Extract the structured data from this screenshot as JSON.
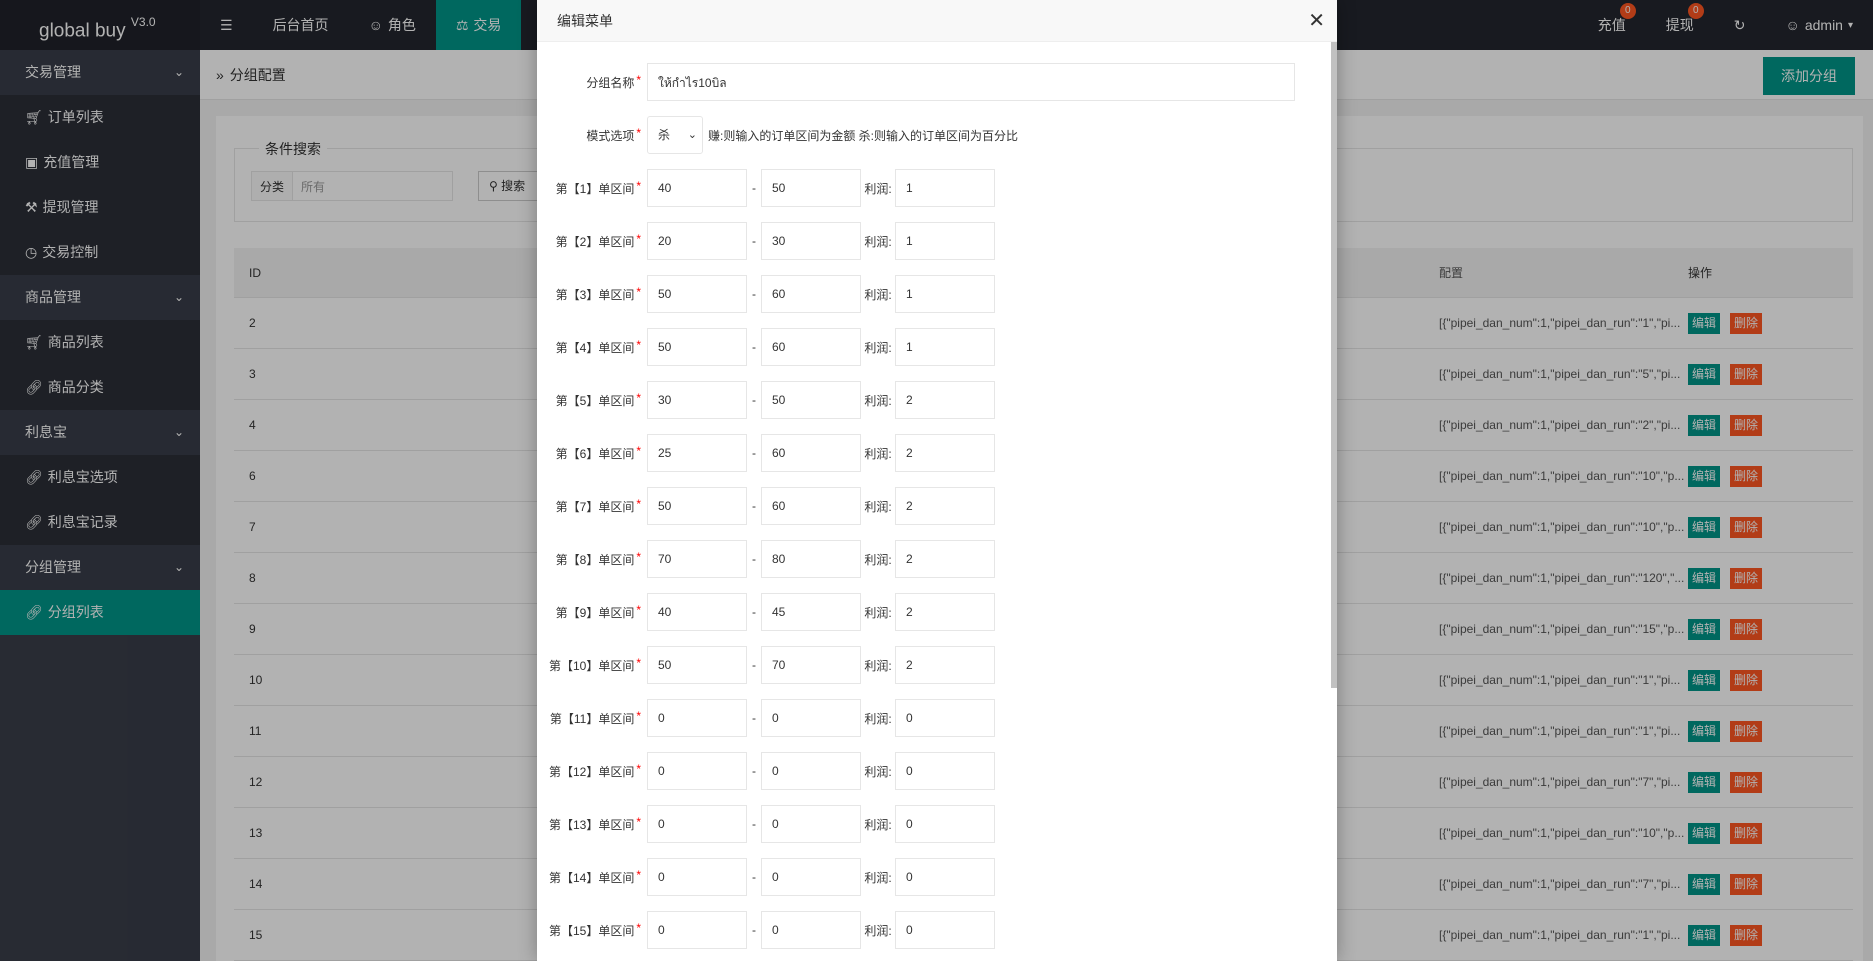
{
  "app": {
    "name": "global buy",
    "version": "V3.0"
  },
  "topnav": {
    "items": [
      {
        "label": "后台首页",
        "icon": "home-icon"
      },
      {
        "label": "角色",
        "icon": "user-icon"
      },
      {
        "label": "交易",
        "icon": "scale-icon"
      }
    ]
  },
  "topright": {
    "recharge": {
      "label": "充值",
      "count": "0"
    },
    "withdraw": {
      "label": "提现",
      "count": "0"
    },
    "user": "admin"
  },
  "sidebar": {
    "groups": [
      {
        "label": "交易管理",
        "items": [
          {
            "label": "订单列表",
            "icon": "cart-icon"
          },
          {
            "label": "充值管理",
            "icon": "card-icon"
          },
          {
            "label": "提现管理",
            "icon": "hammer-icon"
          },
          {
            "label": "交易控制",
            "icon": "gauge-icon"
          }
        ]
      },
      {
        "label": "商品管理",
        "items": [
          {
            "label": "商品列表",
            "icon": "cart-icon"
          },
          {
            "label": "商品分类",
            "icon": "link-icon"
          }
        ]
      },
      {
        "label": "利息宝",
        "items": [
          {
            "label": "利息宝选项",
            "icon": "link-icon"
          },
          {
            "label": "利息宝记录",
            "icon": "link-icon"
          }
        ]
      },
      {
        "label": "分组管理",
        "items": [
          {
            "label": "分组列表",
            "icon": "link-icon",
            "active": true
          }
        ]
      }
    ]
  },
  "page": {
    "breadcrumb": "分组配置",
    "add_button": "添加分组",
    "search": {
      "legend": "条件搜索",
      "category_label": "分类",
      "category_value": "所有",
      "search_button": "搜索"
    },
    "table": {
      "headers": {
        "id": "ID",
        "config": "配置",
        "ops": "操作"
      },
      "edit_label": "编辑",
      "delete_label": "删除",
      "rows": [
        {
          "id": "2",
          "config": "[{\"pipei_dan_num\":1,\"pipei_dan_run\":\"1\",\"pi..."
        },
        {
          "id": "3",
          "config": "[{\"pipei_dan_num\":1,\"pipei_dan_run\":\"5\",\"pi..."
        },
        {
          "id": "4",
          "config": "[{\"pipei_dan_num\":1,\"pipei_dan_run\":\"2\",\"pi..."
        },
        {
          "id": "6",
          "config": "[{\"pipei_dan_num\":1,\"pipei_dan_run\":\"10\",\"p..."
        },
        {
          "id": "7",
          "config": "[{\"pipei_dan_num\":1,\"pipei_dan_run\":\"10\",\"p..."
        },
        {
          "id": "8",
          "config": "[{\"pipei_dan_num\":1,\"pipei_dan_run\":\"120\",\"..."
        },
        {
          "id": "9",
          "config": "[{\"pipei_dan_num\":1,\"pipei_dan_run\":\"15\",\"p..."
        },
        {
          "id": "10",
          "config": "[{\"pipei_dan_num\":1,\"pipei_dan_run\":\"1\",\"pi..."
        },
        {
          "id": "11",
          "config": "[{\"pipei_dan_num\":1,\"pipei_dan_run\":\"1\",\"pi..."
        },
        {
          "id": "12",
          "config": "[{\"pipei_dan_num\":1,\"pipei_dan_run\":\"7\",\"pi..."
        },
        {
          "id": "13",
          "config": "[{\"pipei_dan_num\":1,\"pipei_dan_run\":\"10\",\"p..."
        },
        {
          "id": "14",
          "config": "[{\"pipei_dan_num\":1,\"pipei_dan_run\":\"7\",\"pi..."
        },
        {
          "id": "15",
          "config": "[{\"pipei_dan_num\":1,\"pipei_dan_run\":\"1\",\"pi..."
        }
      ]
    }
  },
  "modal": {
    "title": "编辑菜单",
    "name_label": "分组名称",
    "name_value": "ให้กำไร10บิล",
    "mode_label": "模式选项",
    "mode_value": "杀",
    "mode_hint": "赚:则输入的订单区间为金额 杀:则输入的订单区间为百分比",
    "dash": "-",
    "profit_label": "利润:",
    "ranges": [
      {
        "label": "第【1】单区间",
        "from": "40",
        "to": "50",
        "profit": "1"
      },
      {
        "label": "第【2】单区间",
        "from": "20",
        "to": "30",
        "profit": "1"
      },
      {
        "label": "第【3】单区间",
        "from": "50",
        "to": "60",
        "profit": "1"
      },
      {
        "label": "第【4】单区间",
        "from": "50",
        "to": "60",
        "profit": "1"
      },
      {
        "label": "第【5】单区间",
        "from": "30",
        "to": "50",
        "profit": "2"
      },
      {
        "label": "第【6】单区间",
        "from": "25",
        "to": "60",
        "profit": "2"
      },
      {
        "label": "第【7】单区间",
        "from": "50",
        "to": "60",
        "profit": "2"
      },
      {
        "label": "第【8】单区间",
        "from": "70",
        "to": "80",
        "profit": "2"
      },
      {
        "label": "第【9】单区间",
        "from": "40",
        "to": "45",
        "profit": "2"
      },
      {
        "label": "第【10】单区间",
        "from": "50",
        "to": "70",
        "profit": "2"
      },
      {
        "label": "第【11】单区间",
        "from": "0",
        "to": "0",
        "profit": "0"
      },
      {
        "label": "第【12】单区间",
        "from": "0",
        "to": "0",
        "profit": "0"
      },
      {
        "label": "第【13】单区间",
        "from": "0",
        "to": "0",
        "profit": "0"
      },
      {
        "label": "第【14】单区间",
        "from": "0",
        "to": "0",
        "profit": "0"
      },
      {
        "label": "第【15】单区间",
        "from": "0",
        "to": "0",
        "profit": "0"
      }
    ]
  }
}
